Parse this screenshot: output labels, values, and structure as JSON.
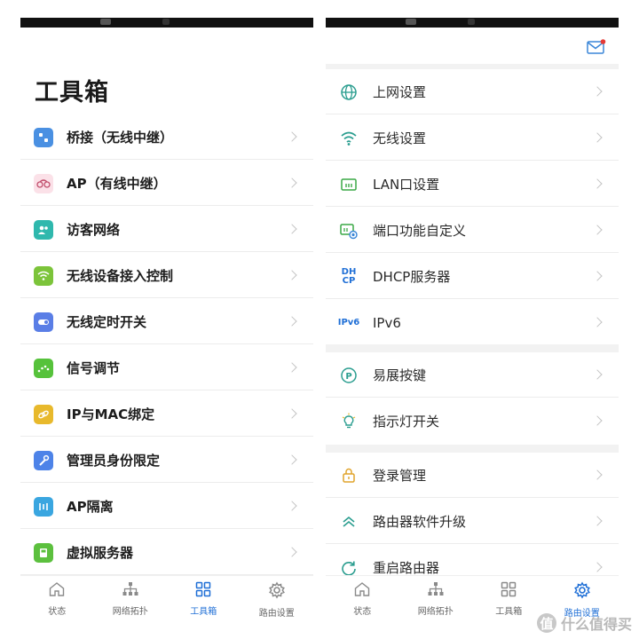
{
  "left": {
    "title": "工具箱",
    "items": [
      {
        "label": "桥接（无线中继）",
        "icon": "bridge-icon",
        "color": "#4a90e2"
      },
      {
        "label": "AP（有线中继）",
        "icon": "ap-icon",
        "color": "#e87f9d"
      },
      {
        "label": "访客网络",
        "icon": "guest-icon",
        "color": "#2fb8ad"
      },
      {
        "label": "无线设备接入控制",
        "icon": "wifi-access-icon",
        "color": "#7cc43a"
      },
      {
        "label": "无线定时开关",
        "icon": "timer-icon",
        "color": "#5a7ee6"
      },
      {
        "label": "信号调节",
        "icon": "signal-icon",
        "color": "#56c23b"
      },
      {
        "label": "IP与MAC绑定",
        "icon": "link-icon",
        "color": "#e8b92c"
      },
      {
        "label": "管理员身份限定",
        "icon": "wrench-icon",
        "color": "#4d83e8"
      },
      {
        "label": "AP隔离",
        "icon": "isolate-icon",
        "color": "#3aa6e0"
      },
      {
        "label": "虚拟服务器",
        "icon": "server-icon",
        "color": "#5cc03e"
      }
    ],
    "tabs": [
      {
        "label": "状态",
        "icon": "home-icon"
      },
      {
        "label": "网络拓扑",
        "icon": "topology-icon"
      },
      {
        "label": "工具箱",
        "icon": "grid-icon",
        "active": true
      },
      {
        "label": "路由设置",
        "icon": "gear-icon"
      }
    ]
  },
  "right": {
    "group1": [
      {
        "label": "上网设置",
        "icon": "globe-icon"
      },
      {
        "label": "无线设置",
        "icon": "wifi-icon"
      },
      {
        "label": "LAN口设置",
        "icon": "lan-port-icon"
      },
      {
        "label": "端口功能自定义",
        "icon": "port-custom-icon"
      },
      {
        "label": "DHCP服务器",
        "icon": "dhcp-icon",
        "icon_text": "DH\nCP"
      },
      {
        "label": "IPv6",
        "icon": "ipv6-icon",
        "icon_text": "IPv6"
      }
    ],
    "group2": [
      {
        "label": "易展按键",
        "icon": "easy-button-icon"
      },
      {
        "label": "指示灯开关",
        "icon": "bulb-icon"
      }
    ],
    "group3": [
      {
        "label": "登录管理",
        "icon": "lock-icon"
      },
      {
        "label": "路由器软件升级",
        "icon": "upgrade-icon"
      },
      {
        "label": "重启路由器",
        "icon": "restart-icon"
      }
    ],
    "tabs": [
      {
        "label": "状态",
        "icon": "home-icon"
      },
      {
        "label": "网络拓扑",
        "icon": "topology-icon"
      },
      {
        "label": "工具箱",
        "icon": "grid-icon"
      },
      {
        "label": "路由设置",
        "icon": "gear-icon",
        "active": true
      }
    ]
  },
  "watermark": {
    "badge": "值",
    "text": "什么值得买"
  },
  "colors": {
    "accent": "#1f6fd6",
    "right_icon": "#2a9d8f",
    "mail_dot": "#e53935"
  }
}
